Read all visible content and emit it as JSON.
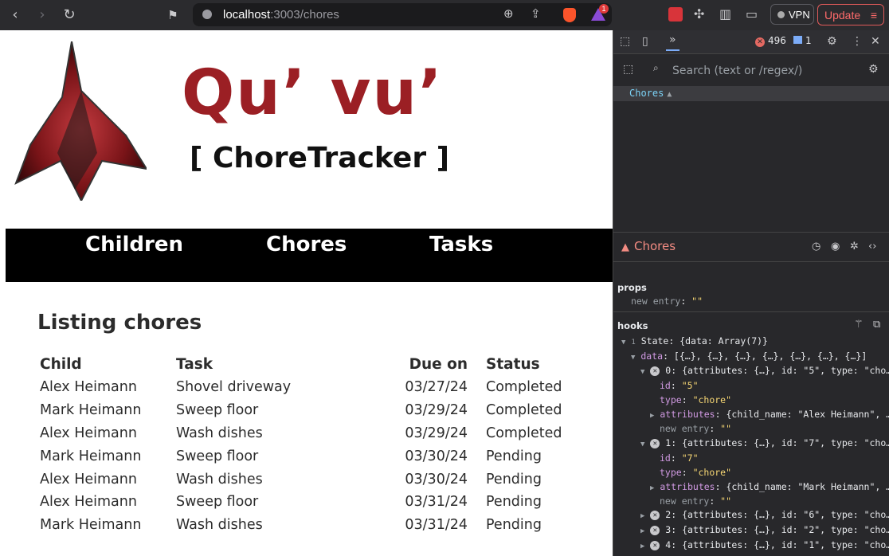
{
  "browser": {
    "url_host": "localhost",
    "url_rest": ":3003/chores",
    "brave_badge": "1",
    "vpn_label": "VPN",
    "update_label": "Update"
  },
  "site": {
    "brand": "Qu’ vu’",
    "subtitle": "[ ChoreTracker ]",
    "nav": [
      "Children",
      "Chores",
      "Tasks"
    ],
    "heading": "Listing chores",
    "table": {
      "headers": [
        "Child",
        "Task",
        "Due on",
        "Status"
      ],
      "rows": [
        [
          "Alex Heimann",
          "Shovel driveway",
          "03/27/24",
          "Completed"
        ],
        [
          "Mark Heimann",
          "Sweep floor",
          "03/29/24",
          "Completed"
        ],
        [
          "Alex Heimann",
          "Wash dishes",
          "03/29/24",
          "Completed"
        ],
        [
          "Mark Heimann",
          "Sweep floor",
          "03/30/24",
          "Pending"
        ],
        [
          "Alex Heimann",
          "Wash dishes",
          "03/30/24",
          "Pending"
        ],
        [
          "Alex Heimann",
          "Sweep floor",
          "03/31/24",
          "Pending"
        ],
        [
          "Mark Heimann",
          "Wash dishes",
          "03/31/24",
          "Pending"
        ]
      ]
    }
  },
  "devtools": {
    "error_count": "496",
    "message_count": "1",
    "search_placeholder": "Search (text or /regex/)",
    "tree_item": "Chores",
    "component_name": "Chores",
    "props_label": "props",
    "props_key": "new entry",
    "props_value": "\"\"",
    "hooks_label": "hooks",
    "hook_index": "1",
    "hook_text": "State: {data: Array(7)}",
    "data_key": "data",
    "data_value": "[{…}, {…}, {…}, {…}, {…}, {…}, {…}]",
    "items": [
      {
        "index": "0",
        "summary": "{attributes: {…}, id: \"5\", type: \"cho…",
        "id": "\"5\"",
        "type": "\"chore\"",
        "attributes": "{child_name: \"Alex Heimann\", …",
        "new_entry": "\"\""
      },
      {
        "index": "1",
        "summary": "{attributes: {…}, id: \"7\", type: \"cho…",
        "id": "\"7\"",
        "type": "\"chore\"",
        "attributes": "{child_name: \"Mark Heimann\", …",
        "new_entry": "\"\""
      }
    ],
    "collapsed": [
      {
        "index": "2",
        "summary": "{attributes: {…}, id: \"6\", type: \"cho…"
      },
      {
        "index": "3",
        "summary": "{attributes: {…}, id: \"2\", type: \"cho…"
      },
      {
        "index": "4",
        "summary": "{attributes: {…}, id: \"1\", type: \"cho…"
      }
    ],
    "key_labels": {
      "id": "id",
      "type": "type",
      "attributes": "attributes",
      "new_entry": "new entry"
    }
  }
}
